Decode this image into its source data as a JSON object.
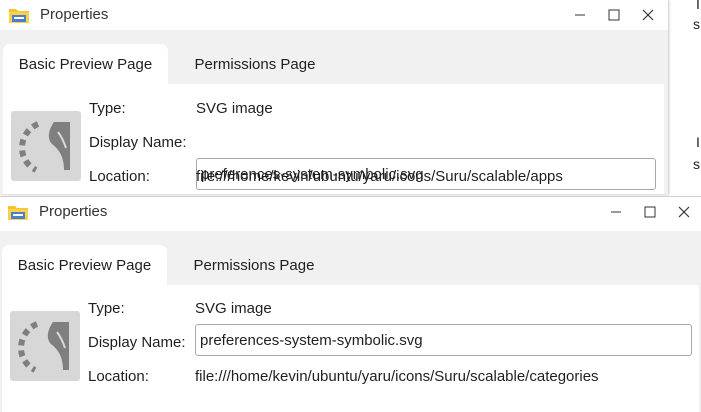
{
  "window": {
    "title": "Properties",
    "icon": "folder-icon",
    "controls": {
      "minimize": "minimize-icon",
      "maximize": "maximize-icon",
      "close": "close-icon"
    }
  },
  "tabs": [
    "Basic Preview Page",
    "Permissions Page"
  ],
  "labels": {
    "type": "Type:",
    "display_name": "Display Name:",
    "location": "Location:"
  },
  "dialogs": [
    {
      "type_value": "SVG image",
      "display_name_value": "preferences-system-symbolic.svg",
      "location_value": "file:///home/kevin/ubuntu/yaru/icons/Suru/scalable/apps"
    },
    {
      "type_value": "SVG image",
      "display_name_value": "preferences-system-symbolic.svg",
      "location_value": "file:///home/kevin/ubuntu/yaru/icons/Suru/scalable/categories"
    }
  ],
  "background_fragments": [
    "I",
    "s",
    "I",
    "s"
  ],
  "colors": {
    "accent": "#2f6fd6",
    "folder": "#f4c430",
    "tab_strip": "#f1f1f1"
  }
}
